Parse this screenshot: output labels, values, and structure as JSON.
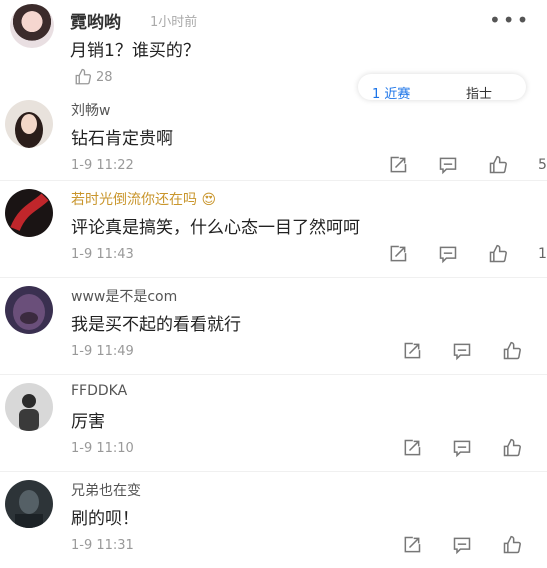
{
  "top_comment": {
    "name": "霓哟哟",
    "time": "1小时前",
    "text": "月销1？谁买的？",
    "likes": "28",
    "pill_left": "1 近赛",
    "pill_right": "指士"
  },
  "replies": [
    {
      "name": "刘畅w",
      "text": "钻石肯定贵啊",
      "date": "1-9 11:22",
      "likes": "5"
    },
    {
      "name": "若时光倒流你还在吗",
      "text": "评论真是搞笑，什么心态一目了然呵呵",
      "date": "1-9 11:43",
      "likes": "1"
    },
    {
      "name": "www是不是com",
      "text": "我是买不起的看看就行",
      "date": "1-9 11:49",
      "likes": ""
    },
    {
      "name": "FFDDKA",
      "text": "厉害",
      "date": "1-9 11:10",
      "likes": ""
    },
    {
      "name": "兄弟也在变",
      "text": "刷的呗！",
      "date": "1-9 11:31",
      "likes": ""
    }
  ],
  "colors": {
    "vip_name": "#c9962d",
    "accent": "#1a73e8"
  }
}
